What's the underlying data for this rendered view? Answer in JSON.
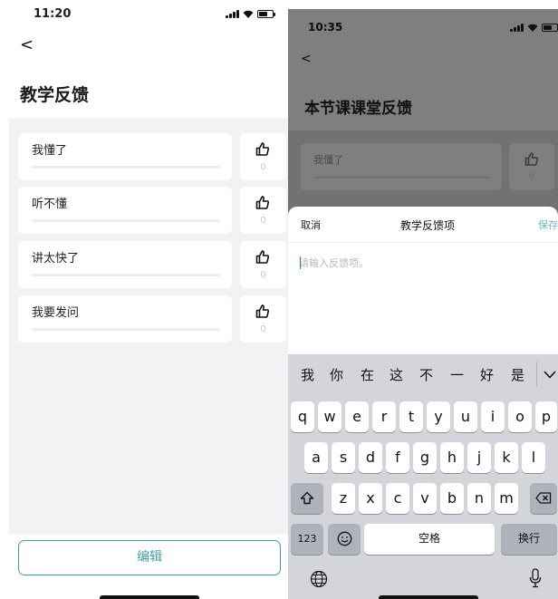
{
  "left_screen": {
    "status_time": "11:20",
    "back": "<",
    "title": "教学反馈",
    "feedback_items": [
      {
        "label": "我懂了",
        "likes": "0"
      },
      {
        "label": "听不懂",
        "likes": "0"
      },
      {
        "label": "讲太快了",
        "likes": "0"
      },
      {
        "label": "我要发问",
        "likes": "0"
      }
    ],
    "edit_label": "编辑"
  },
  "right_screen": {
    "status_time": "10:35",
    "back": "<",
    "title": "本节课课堂反馈",
    "background_items": [
      {
        "label": "我懂了",
        "likes": "0"
      }
    ],
    "sheet": {
      "cancel_label": "取消",
      "title": "教学反馈项",
      "save_label": "保存",
      "input_placeholder": "请输入反馈项。",
      "input_value": ""
    },
    "keyboard": {
      "candidates": [
        "我",
        "你",
        "在",
        "这",
        "不",
        "一",
        "好",
        "是"
      ],
      "collapse_icon": "chevron-down-icon",
      "row1": [
        "q",
        "w",
        "e",
        "r",
        "t",
        "y",
        "u",
        "i",
        "o",
        "p"
      ],
      "row2": [
        "a",
        "s",
        "d",
        "f",
        "g",
        "h",
        "j",
        "k",
        "l"
      ],
      "row3": [
        "z",
        "x",
        "c",
        "v",
        "b",
        "n",
        "m"
      ],
      "num_label": "123",
      "space_label": "空格",
      "return_label": "换行"
    }
  },
  "colors": {
    "accent": "#3f9fa9",
    "save_text": "#6fb6bd",
    "content_bg": "#f2f2f4",
    "keyboard_bg": "#d3d5db"
  }
}
